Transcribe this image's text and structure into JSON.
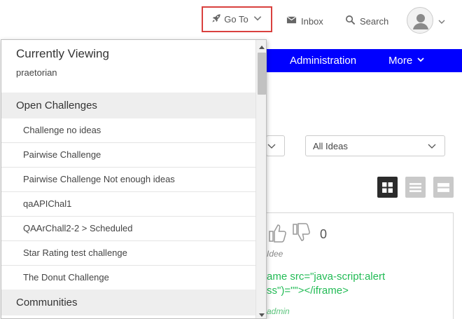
{
  "header": {
    "goto_label": "Go To",
    "inbox_label": "Inbox",
    "search_label": "Search",
    "icons": {
      "goto": "rocket-icon",
      "inbox": "envelope-icon",
      "search": "search-icon",
      "avatar": "user-avatar-icon"
    },
    "goto_highlight_color": "#d9413e"
  },
  "navbar": {
    "color": "#0000ff",
    "items": [
      {
        "label": "Administration"
      },
      {
        "label": "More"
      }
    ]
  },
  "filters": {
    "ideas_select_value": "All Ideas"
  },
  "view_toggles": [
    "grid-view-icon",
    "list-view-icon",
    "wide-view-icon"
  ],
  "idea_card": {
    "like_count": "0",
    "category": "Idee",
    "title": "ame src=\"java-script:alert\nss\")=\"\"></iframe>",
    "author": "admin",
    "title_color": "#22bb55"
  },
  "goto_dropdown": {
    "currently_viewing_title": "Currently Viewing",
    "current_user": "praetorian",
    "open_challenges_title": "Open Challenges",
    "challenges": [
      {
        "label": "Challenge no ideas"
      },
      {
        "label": "Pairwise Challenge"
      },
      {
        "label": "Pairwise Challenge Not enough ideas"
      },
      {
        "label": "qaAPIChal1"
      },
      {
        "label": "QAArChall2-2 > Scheduled"
      },
      {
        "label": "Star Rating test challenge"
      },
      {
        "label": "The Donut Challenge"
      }
    ],
    "communities_title": "Communities"
  }
}
